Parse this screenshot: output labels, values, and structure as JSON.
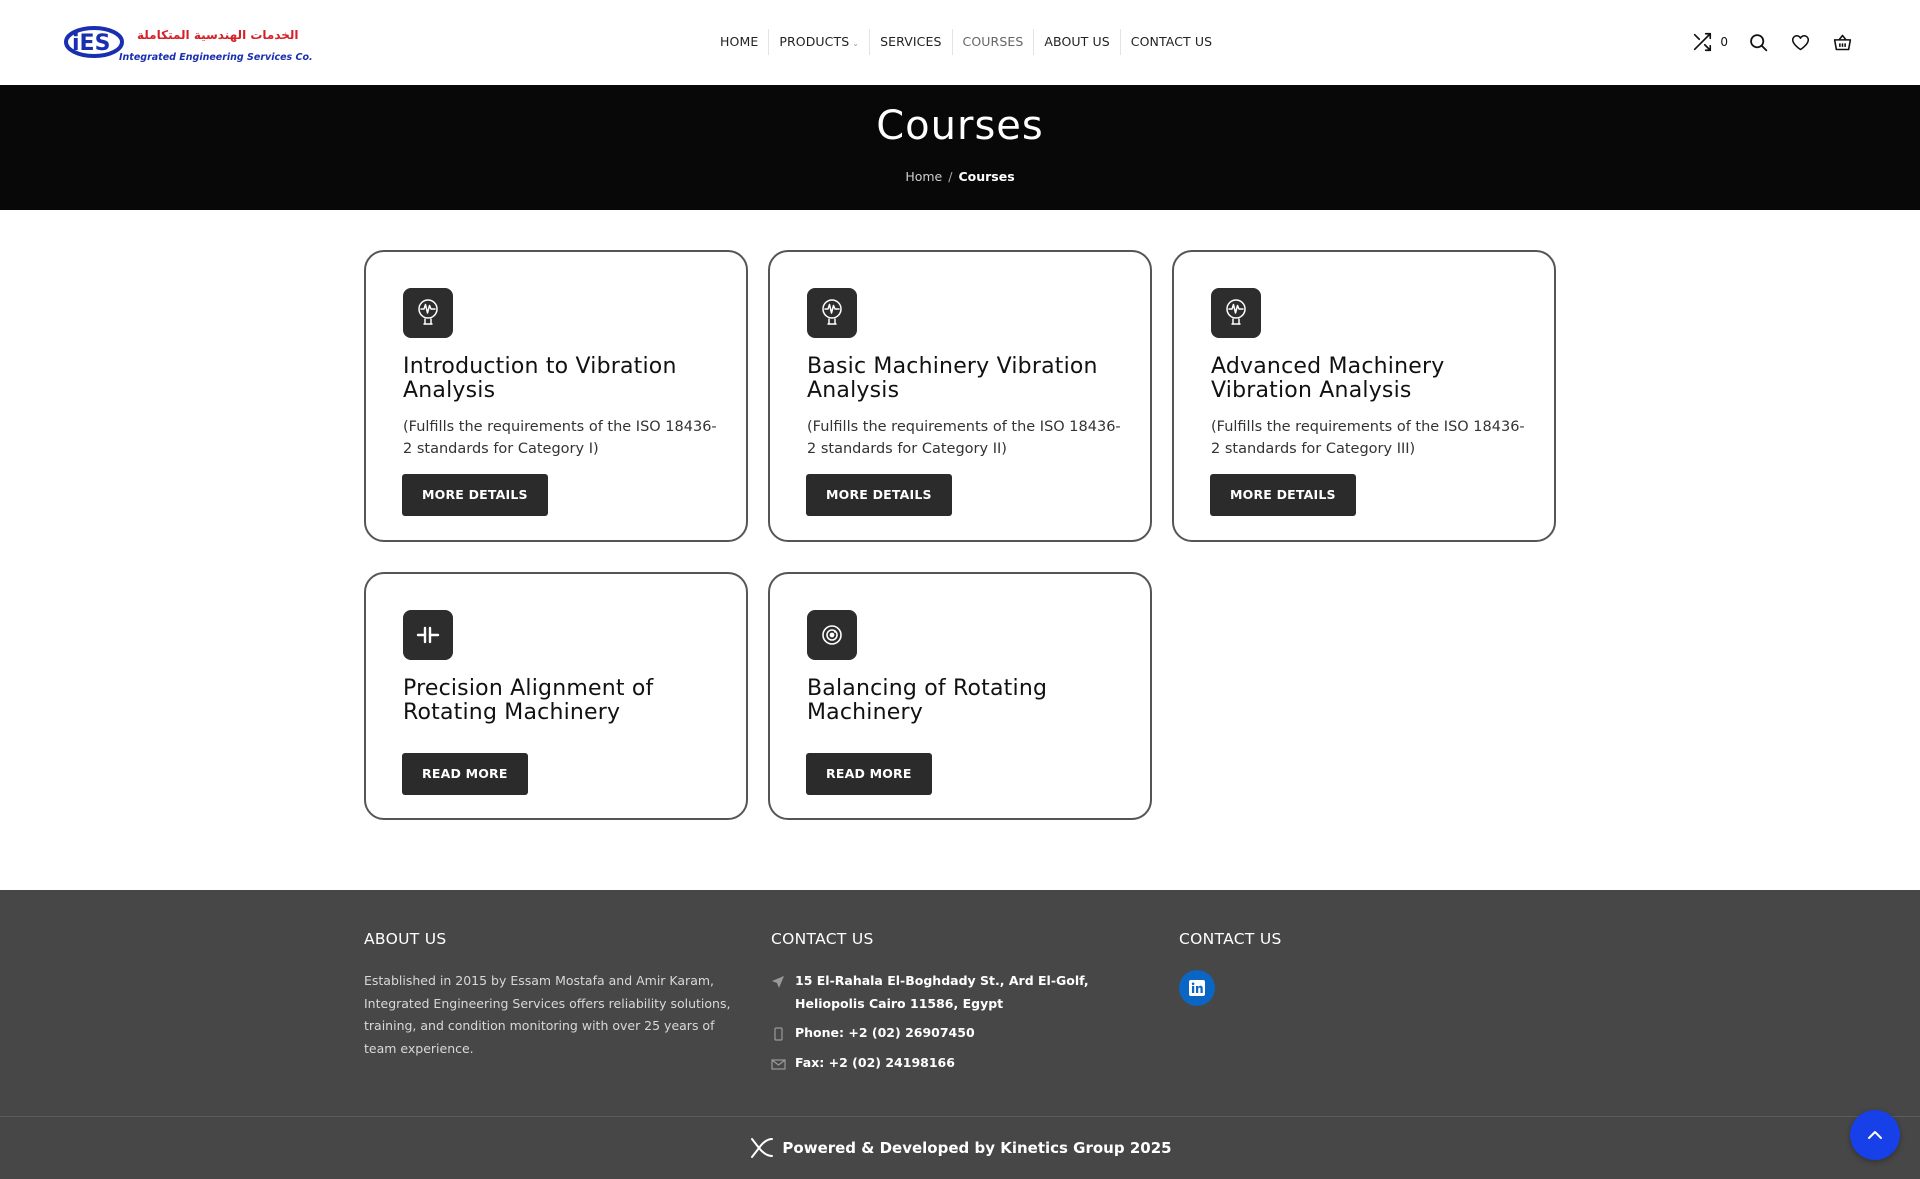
{
  "header": {
    "logo": {
      "mark": "iES",
      "arabic": "الخدمات الهندسية المتكاملة",
      "english": "Integrated Engineering Services Co."
    },
    "nav": [
      {
        "label": "HOME",
        "active": false
      },
      {
        "label": "PRODUCTS",
        "active": false,
        "has_dropdown": true
      },
      {
        "label": "SERVICES",
        "active": false
      },
      {
        "label": "COURSES",
        "active": true
      },
      {
        "label": "ABOUT US",
        "active": false
      },
      {
        "label": "CONTACT US",
        "active": false
      }
    ],
    "compare_count": "0",
    "icons": [
      "compare-icon",
      "search-icon",
      "wishlist-heart-icon",
      "cart-basket-icon"
    ]
  },
  "hero": {
    "title": "Courses",
    "breadcrumb": {
      "home": "Home",
      "separator": "/",
      "current": "Courses"
    }
  },
  "courses": [
    {
      "title": "Introduction to Vibration Analysis",
      "description": "(Fulfills the requirements of the ISO 18436-2 standards for Category I)",
      "button": "MORE DETAILS",
      "icon": "vibration-bulb-icon"
    },
    {
      "title": "Basic Machinery Vibration Analysis",
      "description": "(Fulfills the requirements of the ISO 18436-2 standards for Category II)",
      "button": "MORE DETAILS",
      "icon": "vibration-bulb-icon"
    },
    {
      "title": "Advanced Machinery Vibration Analysis",
      "description": "(Fulfills the requirements of the ISO 18436-2 standards for Category III)",
      "button": "MORE DETAILS",
      "icon": "vibration-bulb-icon"
    },
    {
      "title": "Precision Alignment of Rotating Machinery",
      "description": "",
      "button": "READ MORE",
      "icon": "alignment-icon"
    },
    {
      "title": "Balancing of Rotating Machinery",
      "description": "",
      "button": "READ MORE",
      "icon": "balancing-disc-icon"
    }
  ],
  "footer": {
    "about": {
      "heading": "ABOUT US",
      "text": "Established in 2015 by Essam Mostafa and Amir Karam, Integrated Engineering Services offers reliability solutions, training, and condition monitoring with over 25 years of team experience."
    },
    "contact": {
      "heading": "CONTACT US",
      "address": "15 El-Rahala El-Boghdady St., Ard El-Golf, Heliopolis Cairo 11586, Egypt",
      "phone": "Phone: +2 (02) 26907450",
      "fax": "Fax: +2 (02) 24198166"
    },
    "social": {
      "heading": "CONTACT US",
      "icon": "linkedin-icon"
    },
    "bottom": "Powered & Developed by Kinetics Group 2025"
  },
  "colors": {
    "hero_bg": "#080808",
    "footer_bg": "#474747",
    "button_bg": "#2b2b2b",
    "linkedin": "#0a66c2",
    "scroll_top": "#1840e8",
    "logo_red": "#d61f26",
    "logo_blue": "#1a2fb0"
  }
}
